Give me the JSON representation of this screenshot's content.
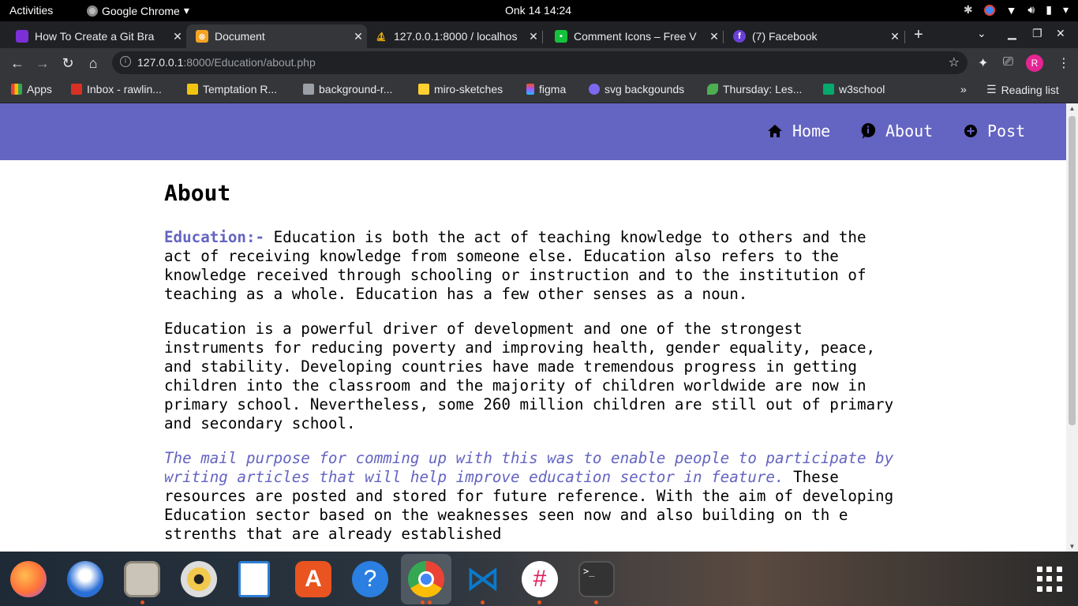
{
  "system": {
    "activities": "Activities",
    "app_name": "Google Chrome",
    "clock": "Onk 14  14:24"
  },
  "tabs": [
    {
      "title": "How To Create a Git Bra",
      "icon": "git-tutorial-favicon",
      "color": "#7b2fd6"
    },
    {
      "title": "Document",
      "icon": "xampp-favicon",
      "color": "#f4a323",
      "active": true
    },
    {
      "title": "127.0.0.1:8000 / localhos",
      "icon": "phpmyadmin-favicon",
      "color": "#f5b400"
    },
    {
      "title": "Comment Icons – Free V",
      "icon": "icons-site-favicon",
      "color": "#14c13b"
    },
    {
      "title": "(7) Facebook",
      "icon": "facebook-favicon",
      "color": "#6a40d8"
    }
  ],
  "browser": {
    "url_host": "127.0.0.1",
    "url_path": ":8000/Education/about.php",
    "profile_initial": "R"
  },
  "bookmarks": [
    {
      "label": "Apps",
      "icon": "apps-grid-icon",
      "color": "#ea4335"
    },
    {
      "label": "Inbox - rawlin...",
      "icon": "gmail-icon",
      "color": "#d93025"
    },
    {
      "label": "Temptation R...",
      "icon": "key-icon",
      "color": "#f1c40f"
    },
    {
      "label": "background-r...",
      "icon": "layers-icon",
      "color": "#9aa0a6"
    },
    {
      "label": "miro-sketches",
      "icon": "miro-icon",
      "color": "#ffd02f"
    },
    {
      "label": "figma",
      "icon": "figma-icon",
      "color": "#f24e1e"
    },
    {
      "label": "svg backgounds",
      "icon": "svg-icon",
      "color": "#7b68ee"
    },
    {
      "label": "Thursday: Les...",
      "icon": "leaf-icon",
      "color": "#4caf50"
    },
    {
      "label": "w3school",
      "icon": "w3schools-icon",
      "color": "#04aa6d"
    }
  ],
  "bookmarks_more": "»",
  "reading_list": "Reading list",
  "site": {
    "nav": [
      {
        "label": "Home",
        "icon": "home-icon"
      },
      {
        "label": "About",
        "icon": "info-bubble-icon"
      },
      {
        "label": "Post",
        "icon": "plus-circle-icon"
      }
    ],
    "heading": "About",
    "p1_keyword": "Education:-",
    "p1_text": " Education is both the act of teaching knowledge to others and the act of receiving knowledge from someone else. Education also refers to the knowledge received through schooling or instruction and to the institution of teaching as a whole. Education has a few other senses as a noun.",
    "p2_text": "Education is a powerful driver of development and one of the strongest instruments for reducing poverty and improving health, gender equality, peace, and stability. Developing countries have made tremendous progress in getting children into the classroom and the majority of children worldwide are now in primary school. Nevertheless, some 260 million children are still out of primary and secondary school.",
    "p3_italic": "The mail purpose for comming up with this was to enable people to participate by writing articles that will help improve education sector in feature.",
    "p3_text": " These resources are posted and stored for future reference. With the aim of developing Education sector based on the weaknesses seen now and also building on th e strenths that are already established",
    "accent_color": "#6464c2"
  },
  "dock": [
    {
      "name": "firefox",
      "color": "#ff7139",
      "dot": false
    },
    {
      "name": "thunderbird",
      "color": "#2a6fd6",
      "dot": false
    },
    {
      "name": "files",
      "color": "#c9c3b8",
      "dot": true
    },
    {
      "name": "rhythmbox",
      "color": "#f2c94c",
      "dot": false
    },
    {
      "name": "libreoffice-writer",
      "color": "#2d7fd3",
      "dot": false
    },
    {
      "name": "ubuntu-software",
      "color": "#e95420",
      "dot": false
    },
    {
      "name": "help",
      "color": "#2a7fe0",
      "dot": false
    },
    {
      "name": "chrome",
      "color": "#4285f4",
      "dot": true,
      "active": true
    },
    {
      "name": "vscode",
      "color": "#0a7acc",
      "dot": true
    },
    {
      "name": "slack",
      "color": "#ffffff",
      "dot": true
    },
    {
      "name": "terminal",
      "color": "#333333",
      "dot": true
    }
  ]
}
